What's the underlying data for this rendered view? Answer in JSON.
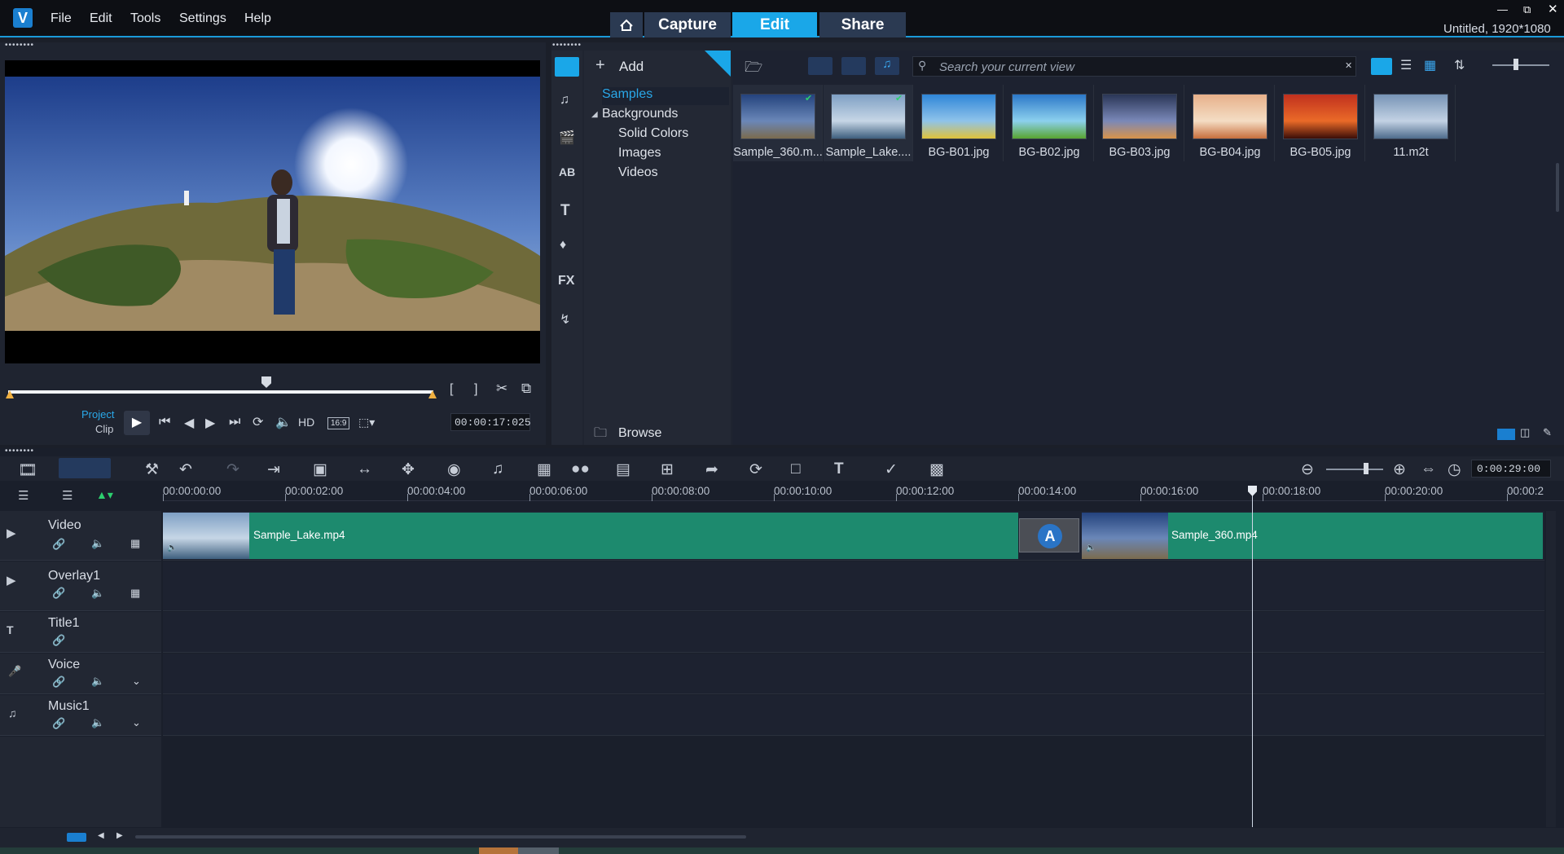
{
  "app": {
    "logo_text": "V",
    "project_info": "Untitled, 1920*1080"
  },
  "menu": [
    "File",
    "Edit",
    "Tools",
    "Settings",
    "Help"
  ],
  "tabs": {
    "capture": "Capture",
    "edit": "Edit",
    "share": "Share"
  },
  "player": {
    "mode_project": "Project",
    "mode_clip": "Clip",
    "hd_label": "HD",
    "aspect": "16:9",
    "timecode": "00:00:17:025"
  },
  "library": {
    "add_label": "Add",
    "search_placeholder": "Search your current view",
    "browse_label": "Browse",
    "tree": {
      "samples": "Samples",
      "backgrounds": "Backgrounds",
      "solid_colors": "Solid Colors",
      "images": "Images",
      "videos": "Videos"
    },
    "sidebar_fx": "FX",
    "thumbs": [
      {
        "label": "Sample_360.m...",
        "colors": [
          "#24437d",
          "#6a87b8",
          "#7b6b4e"
        ]
      },
      {
        "label": "Sample_Lake....",
        "colors": [
          "#7fa0c4",
          "#c6d6e6",
          "#3e5f7e"
        ]
      },
      {
        "label": "BG-B01.jpg",
        "colors": [
          "#2f86d8",
          "#8fc3ea",
          "#e0c23a"
        ]
      },
      {
        "label": "BG-B02.jpg",
        "colors": [
          "#2c78c8",
          "#8cd0ee",
          "#58a530"
        ]
      },
      {
        "label": "BG-B03.jpg",
        "colors": [
          "#2a3656",
          "#7a88b8",
          "#d8934a"
        ]
      },
      {
        "label": "BG-B04.jpg",
        "colors": [
          "#e7b08a",
          "#f4ddc4",
          "#c86f3d"
        ]
      },
      {
        "label": "BG-B05.jpg",
        "colors": [
          "#c0301e",
          "#ea6a28",
          "#3a0d08"
        ]
      },
      {
        "label": "11.m2t",
        "colors": [
          "#7794b6",
          "#c3d2e4",
          "#4e6c8c"
        ]
      }
    ]
  },
  "timeline": {
    "duration": "0:00:29:00",
    "ruler": [
      "00:00:00:00",
      "00:00:02:00",
      "00:00:04:00",
      "00:00:06:00",
      "00:00:08:00",
      "00:00:10:00",
      "00:00:12:00",
      "00:00:14:00",
      "00:00:16:00",
      "00:00:18:00",
      "00:00:20:00",
      "00:00:2"
    ],
    "tracks": [
      "Video",
      "Overlay1",
      "Title1",
      "Voice",
      "Music1"
    ],
    "clips": {
      "lake": "Sample_Lake.mp4",
      "s360": "Sample_360.mp4",
      "transition": "A"
    }
  },
  "colors": {
    "accent": "#1aa7e8",
    "clip": "#1d8a6e",
    "background": "#1b1f29"
  }
}
